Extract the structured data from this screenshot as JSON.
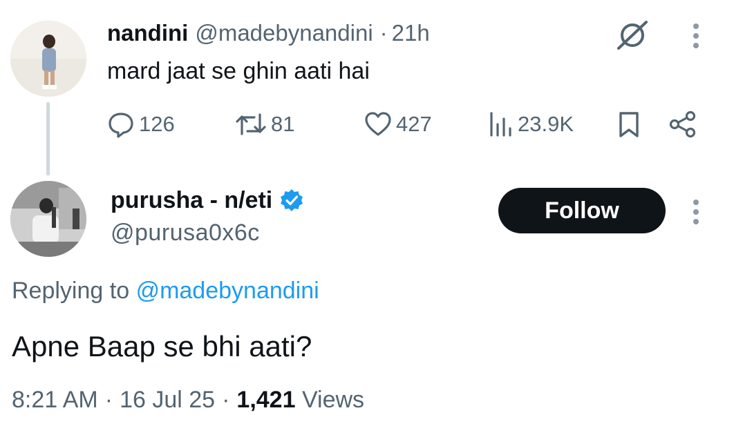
{
  "parent_tweet": {
    "display_name": "nandini",
    "handle": "@madebynandini",
    "separator": "·",
    "time": "21h",
    "text": "mard jaat se ghin aati hai",
    "stats": {
      "replies": "126",
      "reposts": "81",
      "likes": "427",
      "views": "23.9K"
    }
  },
  "main_tweet": {
    "display_name": "purusha - n/eti",
    "verified": true,
    "handle": "@purusa0x6c",
    "follow_label": "Follow",
    "replying_prefix": "Replying to",
    "replying_handle": "@madebynandini",
    "text": "Apne Baap se bhi aati?",
    "time": "8:21 AM",
    "date": "16 Jul 25",
    "separator": "·",
    "views_count": "1,421",
    "views_label": "Views"
  },
  "icons": {
    "grok": "grok-icon",
    "more": "more-dots-icon",
    "reply": "reply-bubble-icon",
    "repost": "repost-icon",
    "like": "heart-icon",
    "views": "bar-chart-icon",
    "bookmark": "bookmark-icon",
    "share": "share-icon",
    "verified": "verified-badge-icon"
  },
  "colors": {
    "text": "#0f1419",
    "muted": "#536471",
    "link": "#1d9bf0",
    "verified": "#1d9bf0",
    "button_bg": "#0f1419",
    "button_text": "#ffffff"
  }
}
